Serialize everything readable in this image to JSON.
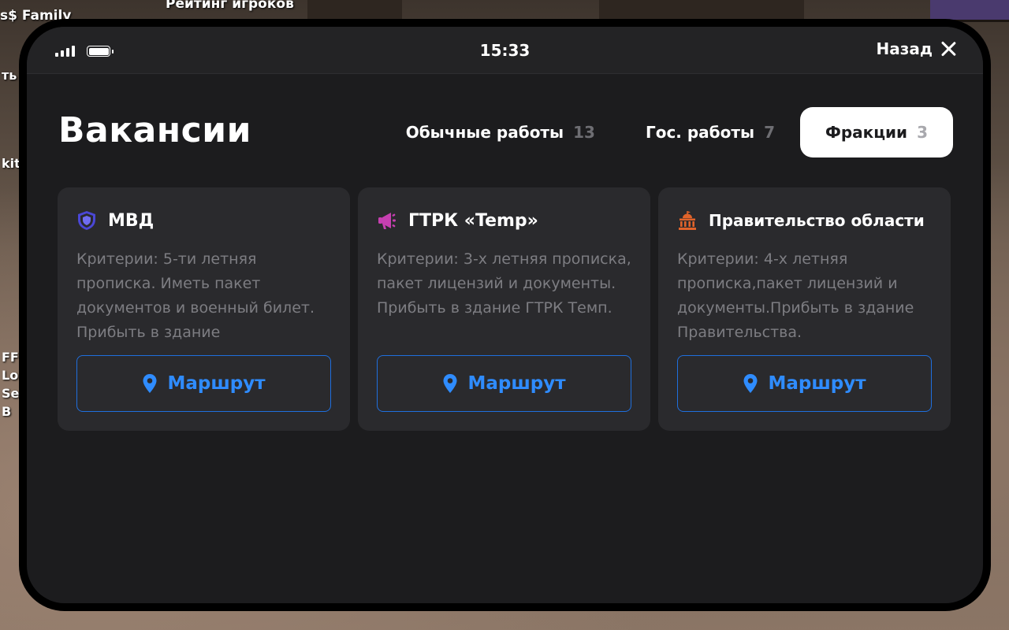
{
  "background": {
    "family_label": "s$ Family",
    "rating_label": "Рейтинг игроков",
    "left_text_1": "ть",
    "left_text_2": "kit",
    "left_text_3": "FF",
    "left_text_4": "Lo",
    "left_text_5": "Se",
    "left_text_6": "B"
  },
  "status_bar": {
    "time": "15:33",
    "back_label": "Назад"
  },
  "page": {
    "title": "Вакансии"
  },
  "tabs": [
    {
      "label": "Обычные работы",
      "count": "13",
      "active": false
    },
    {
      "label": "Гос. работы",
      "count": "7",
      "active": false
    },
    {
      "label": "Фракции",
      "count": "3",
      "active": true
    }
  ],
  "cards": [
    {
      "title": "МВД",
      "icon": "shield-icon",
      "icon_color": "#4a47d6",
      "description": "Критерии: 5-ти летняя прописка. Иметь пакет документов и военный билет. Прибыть в здание",
      "button_label": "Маршрут"
    },
    {
      "title": "ГТРК «Temp»",
      "icon": "megaphone-icon",
      "icon_color": "#c63fb0",
      "description": "Критерии: 3-х  летняя прописка, пакет лицензий и документы. Прибыть в здание ГТРК Темп.",
      "button_label": "Маршрут"
    },
    {
      "title": "Правительство области",
      "icon": "government-building-icon",
      "icon_color": "#e0632a",
      "description": "Критерии: 4-х летняя прописка,пакет лицензий и документы.Прибыть в здание Правительства.",
      "button_label": "Маршрут"
    }
  ],
  "colors": {
    "accent_blue": "#2f8cff",
    "panel_bg": "#1c1c1e",
    "card_bg": "#2a2a2d"
  }
}
